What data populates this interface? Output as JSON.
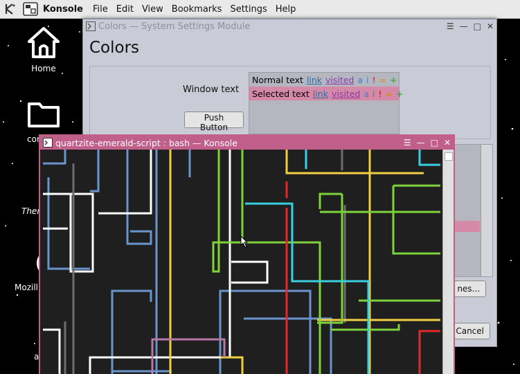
{
  "menubar": {
    "app_name": "Konsole",
    "items": [
      "File",
      "Edit",
      "View",
      "Bookmarks",
      "Settings",
      "Help"
    ],
    "icons": [
      "kde-logo-icon",
      "konsole-app-icon"
    ]
  },
  "desktop": {
    "icons": [
      {
        "label": "Home",
        "icon": "home-icon"
      },
      {
        "label": "con",
        "icon": "folder-icon"
      },
      {
        "label": "Them",
        "icon": "themes-icon"
      },
      {
        "label": "Mozill",
        "icon": "firefox-icon"
      },
      {
        "label": "a",
        "icon": "app-icon"
      }
    ]
  },
  "settings_window": {
    "title": "Colors — System Settings Module",
    "heading": "Colors",
    "window_text_label": "Window text",
    "push_button_label": "Push Button",
    "preview": {
      "normal": {
        "text": "Normal text",
        "link": "link",
        "visited": "visited",
        "a": "a",
        "i": "i",
        "neg": "!",
        "neu": "=",
        "pos": "+"
      },
      "selected": {
        "text": "Selected text",
        "link": "link",
        "visited": "visited",
        "a": "a",
        "i": "i",
        "neg": "!",
        "neu": "=",
        "pos": "+"
      }
    },
    "buttons": {
      "schemes_partial": "nes...",
      "cancel_partial": "Cancel"
    },
    "colors": {
      "bg": "#c9ccd6",
      "selection": "#d48aa6"
    }
  },
  "konsole_window": {
    "title": "quartzite-emerald-script : bash — Konsole",
    "colors": {
      "frame": "#c0608a",
      "terminal_bg": "#1f1f1f"
    }
  }
}
